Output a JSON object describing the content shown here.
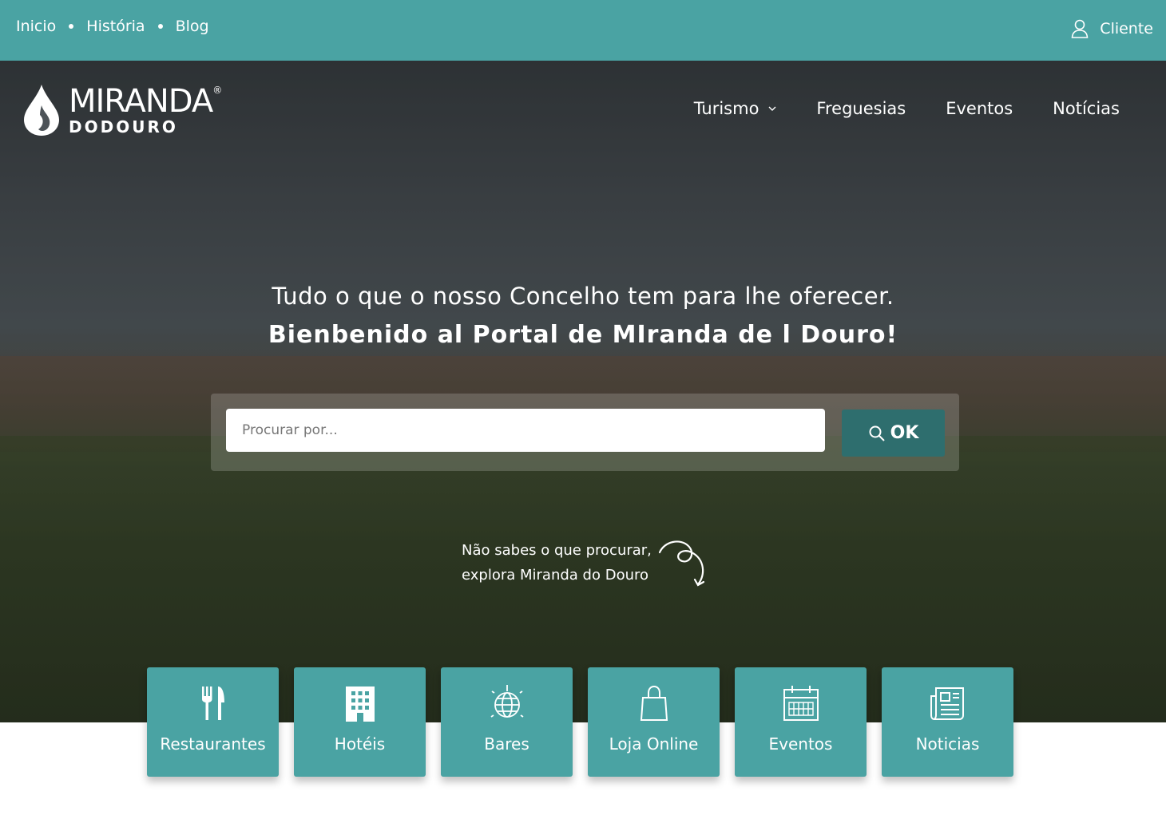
{
  "topbar": {
    "links": [
      "Inicio",
      "História",
      "Blog"
    ],
    "client_label": "Cliente",
    "client_icon": "user-icon",
    "background": "#4aa3a3"
  },
  "logo": {
    "line1": "MIRANDA",
    "registered": "®",
    "line2": "DODOURO",
    "icon": "flame-drop-icon"
  },
  "nav": {
    "items": [
      "Turismo",
      "Freguesias",
      "Eventos",
      "Notícias"
    ],
    "dropdown_icon": "chevron-down-icon"
  },
  "hero": {
    "line1": "Tudo o que o nosso Concelho tem para lhe oferecer.",
    "line2": "Bienbenido al Portal de MIranda de l Douro!"
  },
  "search": {
    "placeholder": "Procurar por...",
    "button_label": "OK",
    "button_icon": "search-icon",
    "button_color": "#2e6e6e"
  },
  "explore": {
    "line1": "Não sabes o que procurar,",
    "line2": "explora Miranda do Douro",
    "icon": "swirl-arrow-icon"
  },
  "cards": [
    {
      "label": "Restaurantes",
      "icon": "fork-knife-icon"
    },
    {
      "label": "Hotéis",
      "icon": "building-icon"
    },
    {
      "label": "Bares",
      "icon": "disco-ball-icon"
    },
    {
      "label": "Loja Online",
      "icon": "shopping-bag-icon"
    },
    {
      "label": "Eventos",
      "icon": "calendar-icon"
    },
    {
      "label": "Noticias",
      "icon": "newspaper-icon"
    }
  ],
  "accent_color": "#4aa3a3"
}
